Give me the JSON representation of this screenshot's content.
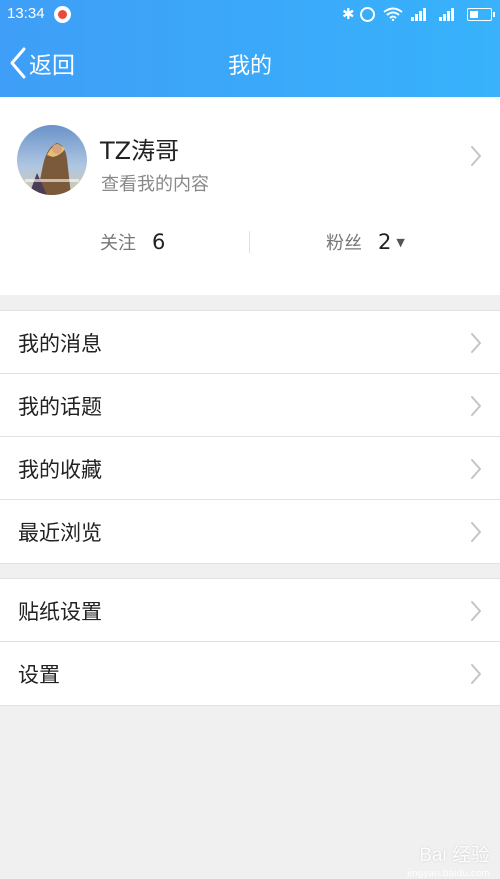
{
  "status_bar": {
    "time": "13:34",
    "icons": [
      "app-notification-icon",
      "bluetooth-icon",
      "alarm-icon",
      "wifi-icon",
      "signal-icon",
      "signal-icon",
      "battery-icon"
    ]
  },
  "nav": {
    "back_label": "返回",
    "title": "我的"
  },
  "profile": {
    "name": "TZ涛哥",
    "subtitle": "查看我的内容",
    "follow_label": "关注",
    "follow_count": "6",
    "fans_label": "粉丝",
    "fans_count": "2"
  },
  "menu_group_1": [
    {
      "label": "我的消息"
    },
    {
      "label": "我的话题"
    },
    {
      "label": "我的收藏"
    },
    {
      "label": "最近浏览"
    }
  ],
  "menu_group_2": [
    {
      "label": "贴纸设置"
    },
    {
      "label": "设置"
    }
  ],
  "watermark": {
    "text": "Bai 经验",
    "sub": "jingyan.baidu.com"
  },
  "colors": {
    "header_start": "#3f9ef7",
    "header_end": "#37b2fb",
    "background": "#f0f0f0",
    "text_primary": "#222222",
    "text_secondary": "#888888"
  }
}
